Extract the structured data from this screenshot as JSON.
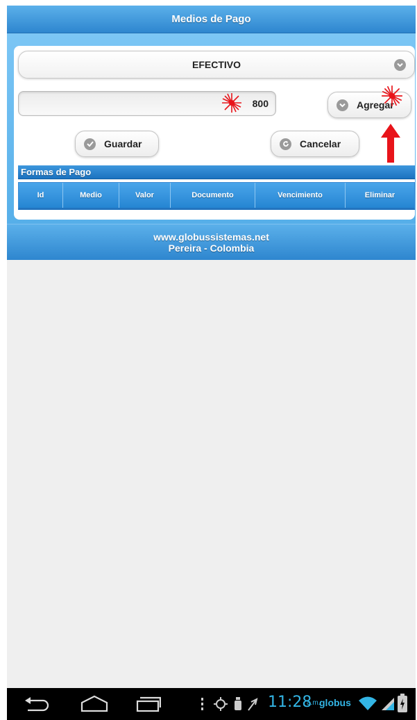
{
  "header": {
    "title": "Medios de Pago"
  },
  "form": {
    "medio_selected": "EFECTIVO",
    "valor": "800",
    "agregar_label": "Agregar",
    "guardar_label": "Guardar",
    "cancelar_label": "Cancelar"
  },
  "formas": {
    "title": "Formas de Pago",
    "columns": [
      "Id",
      "Medio",
      "Valor",
      "Documento",
      "Vencimiento",
      "Eliminar"
    ]
  },
  "footer": {
    "line1": "www.globussistemas.net",
    "line2": "Pereira - Colombia"
  },
  "statusbar": {
    "time": "11:28",
    "ampm": "a.m.",
    "carrier": "globus"
  },
  "colors": {
    "header_blue": "#2e86cf",
    "panel_blue": "#56afe9",
    "clock_cyan": "#33b5e5",
    "annotation_red": "#e8141a"
  },
  "icons": [
    "chevron-down-icon",
    "check-icon",
    "refresh-icon",
    "back-icon",
    "home-icon",
    "recent-apps-icon",
    "wifi-icon",
    "signal-icon",
    "battery-icon"
  ]
}
